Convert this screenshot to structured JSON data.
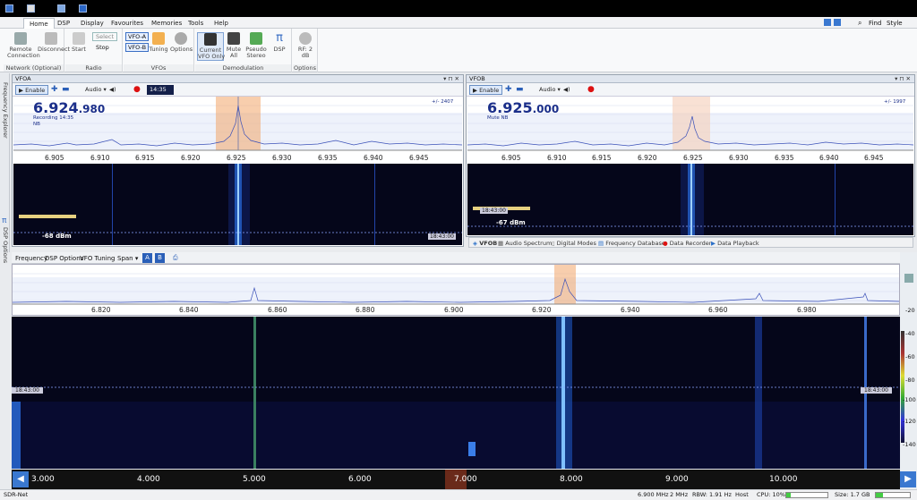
{
  "tabs": [
    "Home",
    "DSP",
    "Display",
    "Favourites",
    "Memories",
    "Tools",
    "Help"
  ],
  "top_right": {
    "find": "Find",
    "style": "Style"
  },
  "ribbon": {
    "network": {
      "label": "Network (Optional)",
      "remote": "Remote\nConnection",
      "disconnect": "Disconnect"
    },
    "radio": {
      "label": "Radio",
      "start": "Start",
      "select": "Select",
      "stop": "Stop"
    },
    "vfos": {
      "label": "VFOs",
      "vfoa": "VFO-A",
      "vfob": "VFO-B",
      "tuning": "Tuning",
      "options": "Options"
    },
    "demod": {
      "label": "Demodulation",
      "current_vfo": "Current\nVFO Only",
      "mute_all": "Mute\nAll",
      "pseudo": "Pseudo\nStereo",
      "dsp": "DSP"
    },
    "options": {
      "label": "Options",
      "rf": "RF: 2 dB"
    }
  },
  "sidebar": {
    "freq_explorer": "Frequency Explorer",
    "dsp_options": "DSP Options"
  },
  "vfoa": {
    "title": "VFOA",
    "enable": "Enable",
    "audio": "Audio",
    "time": "14:35",
    "freq_main": "6.924",
    "freq_small": ".980",
    "recording": "Recording 14:35",
    "nb": "NB",
    "offset": "+/- 2407",
    "level": "-68 dBm",
    "timestamp": "18:43:00",
    "ticks": [
      "6.905",
      "6.910",
      "6.915",
      "6.920",
      "6.925",
      "6.930",
      "6.935",
      "6.940",
      "6.945"
    ]
  },
  "vfob": {
    "title": "VFOB",
    "enable": "Enable",
    "audio": "Audio",
    "freq_main": "6.925",
    "freq_small": ".000",
    "mute": "Mute NB",
    "offset": "+/- 1997",
    "level": "-67 dBm",
    "timestamp": "18:43:00",
    "ticks": [
      "6.905",
      "6.910",
      "6.915",
      "6.920",
      "6.925",
      "6.930",
      "6.935",
      "6.940",
      "6.945"
    ],
    "bottom_tabs": [
      "VFOB",
      "Audio Spectrum",
      "Digital Modes",
      "Frequency Database",
      "Data Recorder",
      "Data Playback"
    ]
  },
  "main": {
    "toolbar": [
      "Frequency",
      "DSP Options",
      "VFO Tuning",
      "Span"
    ],
    "ab": [
      "A",
      "B"
    ],
    "ticks": [
      "6.820",
      "6.840",
      "6.860",
      "6.880",
      "6.900",
      "6.920",
      "6.940",
      "6.960",
      "6.980"
    ],
    "timestamp": "18:43:00",
    "scale": [
      "-20",
      "-40",
      "-60",
      "-80",
      "-100",
      "-120",
      "-140"
    ],
    "band": [
      "3.000",
      "4.000",
      "5.000",
      "6.000",
      "7.000",
      "8.000",
      "9.000",
      "10.000"
    ]
  },
  "status": {
    "app": "SDR-Net",
    "freq": "6.900 MHz",
    "span": "2 MHz",
    "rbw": "RBW: 1.91 Hz",
    "host": "Host",
    "cpu": "CPU: 10%",
    "size": "Size: 1.7 GB"
  }
}
